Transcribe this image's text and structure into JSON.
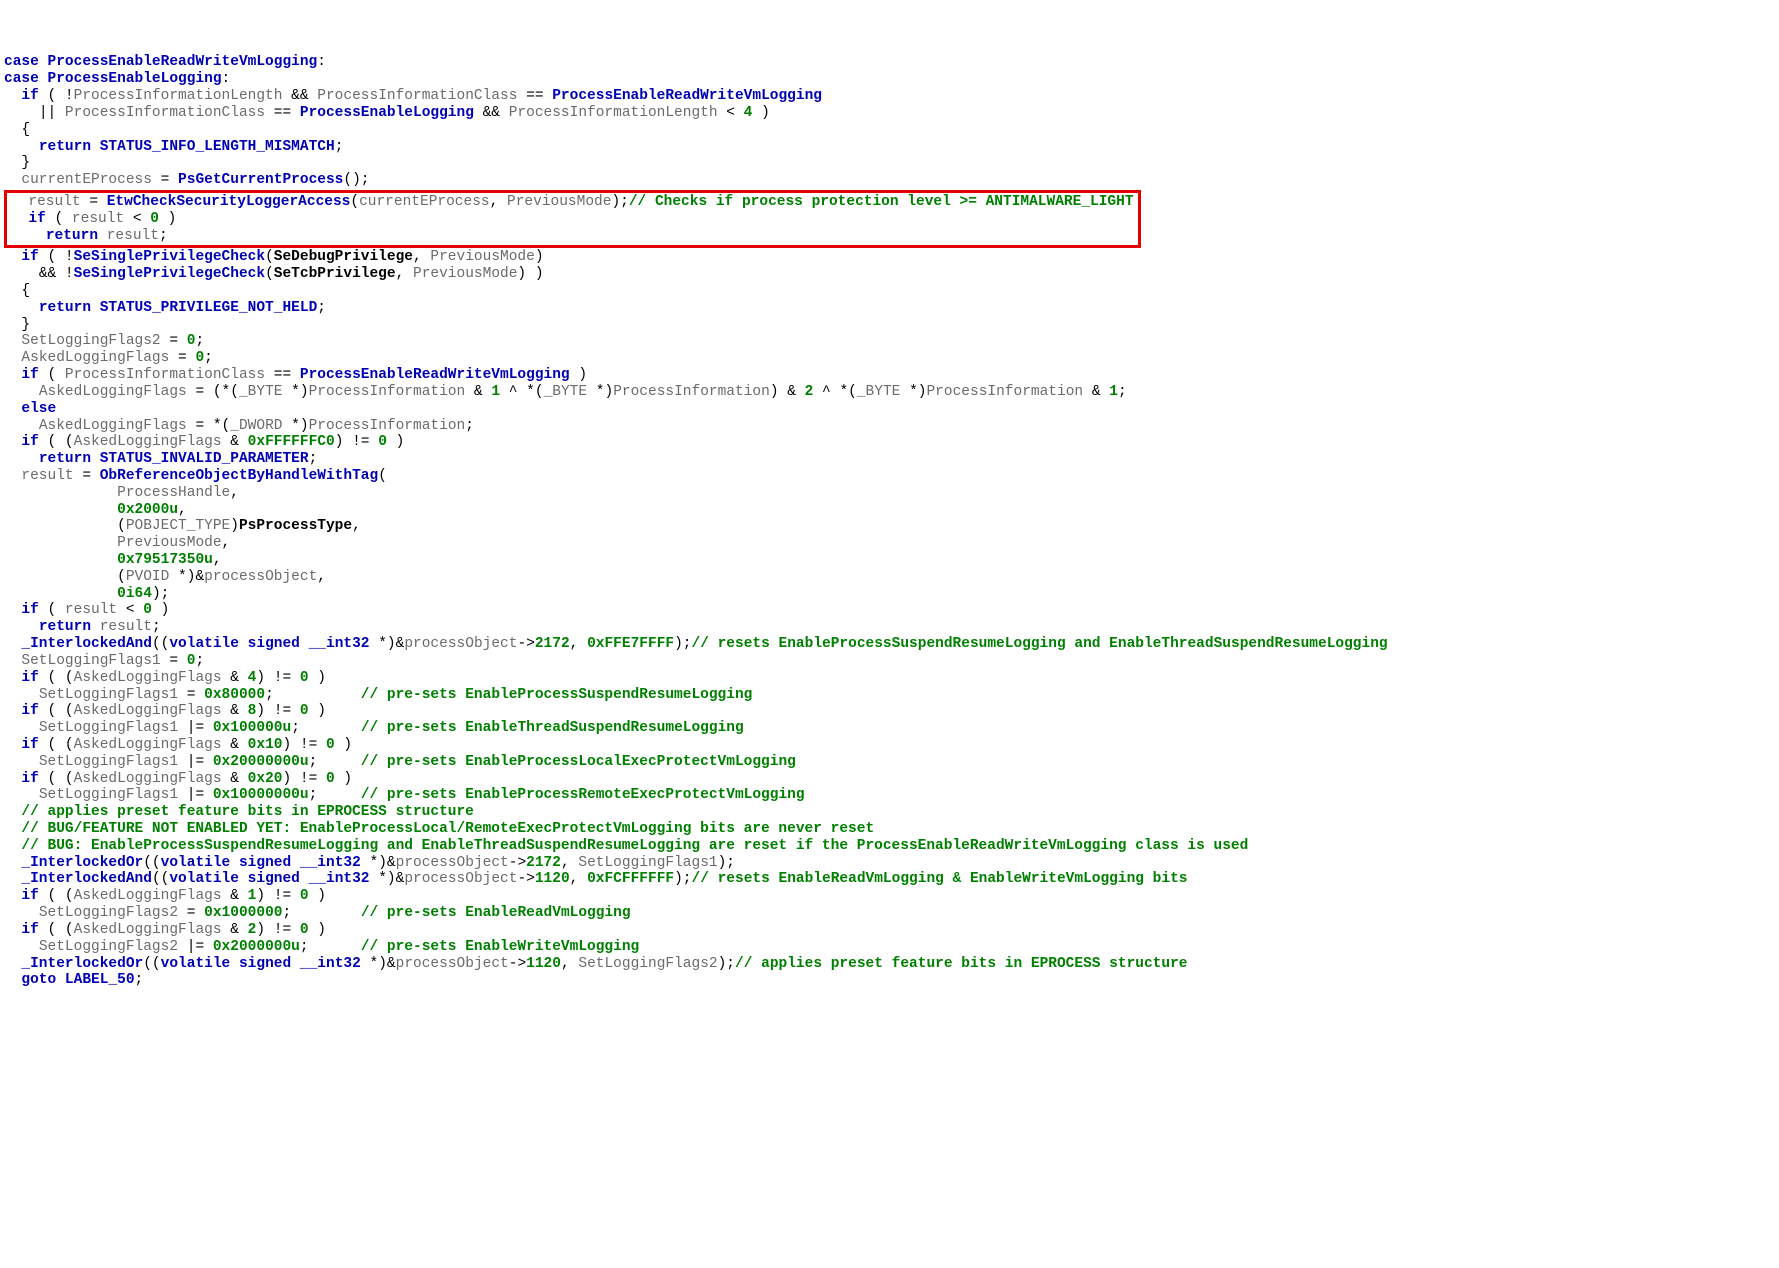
{
  "code": {
    "l01a": "case",
    "l01b": "ProcessEnableReadWriteVmLogging",
    "l01c": ":",
    "l02a": "case",
    "l02b": "ProcessEnableLogging",
    "l02c": ":",
    "l03a": "if",
    "l03b": "( !",
    "l03c": "ProcessInformationLength",
    "l03d": " && ",
    "l03e": "ProcessInformationClass",
    "l03f": " == ",
    "l03g": "ProcessEnableReadWriteVmLogging",
    "l04a": "|| ",
    "l04b": "ProcessInformationClass",
    "l04c": " == ",
    "l04d": "ProcessEnableLogging",
    "l04e": " && ",
    "l04f": "ProcessInformationLength",
    "l04g": " < ",
    "l04h": "4",
    "l04i": " )",
    "l05a": "{",
    "l06a": "return",
    "l06b": "STATUS_INFO_LENGTH_MISMATCH",
    "l06c": ";",
    "l07a": "}",
    "l08a": "currentEProcess",
    "l08b": " = ",
    "l08c": "PsGetCurrentProcess",
    "l08d": "();",
    "l09a": "result",
    "l09b": " = ",
    "l09c": "EtwCheckSecurityLoggerAccess",
    "l09d": "(",
    "l09e": "currentEProcess",
    "l09f": ", ",
    "l09g": "PreviousMode",
    "l09h": ");",
    "l09i": "// Checks if process protection level >= ANTIMALWARE_LIGHT",
    "l10a": "if",
    "l10b": " ( ",
    "l10c": "result",
    "l10d": " < ",
    "l10e": "0",
    "l10f": " )",
    "l11a": "return",
    "l11b": "result",
    "l11c": ";",
    "l12a": "if",
    "l12b": " ( !",
    "l12c": "SeSinglePrivilegeCheck",
    "l12d": "(",
    "l12e": "SeDebugPrivilege",
    "l12f": ", ",
    "l12g": "PreviousMode",
    "l12h": ")",
    "l13a": "&& !",
    "l13b": "SeSinglePrivilegeCheck",
    "l13c": "(",
    "l13d": "SeTcbPrivilege",
    "l13e": ", ",
    "l13f": "PreviousMode",
    "l13g": ") )",
    "l14a": "{",
    "l15a": "return",
    "l15b": "STATUS_PRIVILEGE_NOT_HELD",
    "l15c": ";",
    "l16a": "}",
    "l17a": "SetLoggingFlags2",
    "l17b": " = ",
    "l17c": "0",
    "l17d": ";",
    "l18a": "AskedLoggingFlags",
    "l18b": " = ",
    "l18c": "0",
    "l18d": ";",
    "l19a": "if",
    "l19b": " ( ",
    "l19c": "ProcessInformationClass",
    "l19d": " == ",
    "l19e": "ProcessEnableReadWriteVmLogging",
    "l19f": " )",
    "l20a": "AskedLoggingFlags",
    "l20b": " = (*(",
    "l20c": "_BYTE",
    "l20d": " *)",
    "l20e": "ProcessInformation",
    "l20f": " & ",
    "l20g": "1",
    "l20h": " ^ *(",
    "l20i": "_BYTE",
    "l20j": " *)",
    "l20k": "ProcessInformation",
    "l20l": ") & ",
    "l20m": "2",
    "l20n": " ^ *(",
    "l20o": "_BYTE",
    "l20p": " *)",
    "l20q": "ProcessInformation",
    "l20r": " & ",
    "l20s": "1",
    "l20t": ";",
    "l21a": "else",
    "l22a": "AskedLoggingFlags",
    "l22b": " = *(",
    "l22c": "_DWORD",
    "l22d": " *)",
    "l22e": "ProcessInformation",
    "l22f": ";",
    "l23a": "if",
    "l23b": " ( (",
    "l23c": "AskedLoggingFlags",
    "l23d": " & ",
    "l23e": "0xFFFFFFC0",
    "l23f": ") != ",
    "l23g": "0",
    "l23h": " )",
    "l24a": "return",
    "l24b": "STATUS_INVALID_PARAMETER",
    "l24c": ";",
    "l25a": "result",
    "l25b": " = ",
    "l25c": "ObReferenceObjectByHandleWithTag",
    "l25d": "(",
    "l26a": "ProcessHandle",
    "l26b": ",",
    "l27a": "0x2000u",
    "l27b": ",",
    "l28a": "(",
    "l28b": "POBJECT_TYPE",
    "l28c": ")",
    "l28d": "PsProcessType",
    "l28e": ",",
    "l29a": "PreviousMode",
    "l29b": ",",
    "l30a": "0x79517350u",
    "l30b": ",",
    "l31a": "(",
    "l31b": "PVOID",
    "l31c": " *)&",
    "l31d": "processObject",
    "l31e": ",",
    "l32a": "0i64",
    "l32b": ");",
    "l33a": "if",
    "l33b": " ( ",
    "l33c": "result",
    "l33d": " < ",
    "l33e": "0",
    "l33f": " )",
    "l34a": "return",
    "l34b": "result",
    "l34c": ";",
    "l35a": "_InterlockedAnd",
    "l35b": "((",
    "l35c": "volatile",
    "l35d": " ",
    "l35e": "signed",
    "l35f": " ",
    "l35g": "__int32",
    "l35h": " *)&",
    "l35i": "processObject",
    "l35j": "->",
    "l35k": "2172",
    "l35l": ", ",
    "l35m": "0xFFE7FFFF",
    "l35n": ");",
    "l35o": "// resets EnableProcessSuspendResumeLogging and EnableThreadSuspendResumeLogging",
    "l36a": "SetLoggingFlags1",
    "l36b": " = ",
    "l36c": "0",
    "l36d": ";",
    "l37a": "if",
    "l37b": " ( (",
    "l37c": "AskedLoggingFlags",
    "l37d": " & ",
    "l37e": "4",
    "l37f": ") != ",
    "l37g": "0",
    "l37h": " )",
    "l38a": "SetLoggingFlags1",
    "l38b": " = ",
    "l38c": "0x80000",
    "l38d": ";",
    "l38e": "// pre-sets EnableProcessSuspendResumeLogging",
    "l39a": "if",
    "l39b": " ( (",
    "l39c": "AskedLoggingFlags",
    "l39d": " & ",
    "l39e": "8",
    "l39f": ") != ",
    "l39g": "0",
    "l39h": " )",
    "l40a": "SetLoggingFlags1",
    "l40b": " |= ",
    "l40c": "0x100000u",
    "l40d": ";",
    "l40e": "// pre-sets EnableThreadSuspendResumeLogging",
    "l41a": "if",
    "l41b": " ( (",
    "l41c": "AskedLoggingFlags",
    "l41d": " & ",
    "l41e": "0x10",
    "l41f": ") != ",
    "l41g": "0",
    "l41h": " )",
    "l42a": "SetLoggingFlags1",
    "l42b": " |= ",
    "l42c": "0x20000000u",
    "l42d": ";",
    "l42e": "// pre-sets EnableProcessLocalExecProtectVmLogging",
    "l43a": "if",
    "l43b": " ( (",
    "l43c": "AskedLoggingFlags",
    "l43d": " & ",
    "l43e": "0x20",
    "l43f": ") != ",
    "l43g": "0",
    "l43h": " )",
    "l44a": "SetLoggingFlags1",
    "l44b": " |= ",
    "l44c": "0x10000000u",
    "l44d": ";",
    "l44e": "// pre-sets EnableProcessRemoteExecProtectVmLogging",
    "l45": "// applies preset feature bits in EPROCESS structure",
    "l46": "// BUG/FEATURE NOT ENABLED YET: EnableProcessLocal/RemoteExecProtectVmLogging bits are never reset",
    "l47": "// BUG: EnableProcessSuspendResumeLogging and EnableThreadSuspendResumeLogging are reset if the ProcessEnableReadWriteVmLogging class is used",
    "l48a": "_InterlockedOr",
    "l48b": "((",
    "l48c": "volatile",
    "l48d": " ",
    "l48e": "signed",
    "l48f": " ",
    "l48g": "__int32",
    "l48h": " *)&",
    "l48i": "processObject",
    "l48j": "->",
    "l48k": "2172",
    "l48l": ", ",
    "l48m": "SetLoggingFlags1",
    "l48n": ");",
    "l49a": "_InterlockedAnd",
    "l49b": "((",
    "l49c": "volatile",
    "l49d": " ",
    "l49e": "signed",
    "l49f": " ",
    "l49g": "__int32",
    "l49h": " *)&",
    "l49i": "processObject",
    "l49j": "->",
    "l49k": "1120",
    "l49l": ", ",
    "l49m": "0xFCFFFFFF",
    "l49n": ");",
    "l49o": "// resets EnableReadVmLogging & EnableWriteVmLogging bits",
    "l50a": "if",
    "l50b": " ( (",
    "l50c": "AskedLoggingFlags",
    "l50d": " & ",
    "l50e": "1",
    "l50f": ") != ",
    "l50g": "0",
    "l50h": " )",
    "l51a": "SetLoggingFlags2",
    "l51b": " = ",
    "l51c": "0x1000000",
    "l51d": ";",
    "l51e": "// pre-sets EnableReadVmLogging",
    "l52a": "if",
    "l52b": " ( (",
    "l52c": "AskedLoggingFlags",
    "l52d": " & ",
    "l52e": "2",
    "l52f": ") != ",
    "l52g": "0",
    "l52h": " )",
    "l53a": "SetLoggingFlags2",
    "l53b": " |= ",
    "l53c": "0x2000000u",
    "l53d": ";",
    "l53e": "// pre-sets EnableWriteVmLogging",
    "l54a": "_InterlockedOr",
    "l54b": "((",
    "l54c": "volatile",
    "l54d": " ",
    "l54e": "signed",
    "l54f": " ",
    "l54g": "__int32",
    "l54h": " *)&",
    "l54i": "processObject",
    "l54j": "->",
    "l54k": "1120",
    "l54l": ", ",
    "l54m": "SetLoggingFlags2",
    "l54n": ");",
    "l54o": "// applies preset feature bits in EPROCESS structure",
    "l55a": "goto",
    "l55b": "LABEL_50",
    "l55c": ";"
  }
}
